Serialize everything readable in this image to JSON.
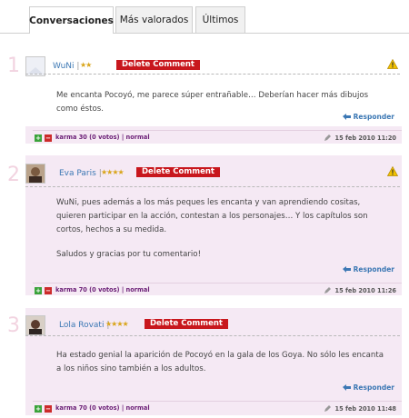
{
  "tabs": [
    "Conversaciones",
    "Más valorados",
    "Últimos"
  ],
  "delete_label": "Delete Comment",
  "reply_label": "Responder",
  "comments": [
    {
      "number": "1",
      "author": "WuNi",
      "stars": "★★",
      "body": [
        "Me encanta Pocoyó, me parece súper entrañable… Deberían hacer más dibujos como éstos."
      ],
      "karma": "karma 30 (0 votos) | normal",
      "date": "15 feb 2010 11:20",
      "avatar": "blank-avatar"
    },
    {
      "number": "2",
      "author": "Eva Paris",
      "stars": "★★★★",
      "body": [
        "WuNi, pues además a los más peques les encanta y van aprendiendo cositas, quieren participar en la acción, contestan a los personajes… Y los capítulos son cortos, hechos a su medida.",
        "Saludos y gracias por tu comentario!"
      ],
      "karma": "karma 70 (0 votos) | normal",
      "date": "15 feb 2010 11:26",
      "avatar": "photo-avatar"
    },
    {
      "number": "3",
      "author": "Lola Rovati",
      "stars": "★★★★",
      "body": [
        "Ha estado genial la aparición de Pocoyó en la gala de los Goya. No sólo les encanta a los niños sino también a los adultos."
      ],
      "karma": "karma 70 (0 votos) | normal",
      "date": "15 feb 2010 11:48",
      "avatar": "photo-avatar"
    }
  ],
  "colors": {
    "comment_bg": "#f5e9f4",
    "author": "#3c78b4",
    "delete_button": "#c8171d",
    "karma": "#6b1f76",
    "number": "#f2d3e0"
  }
}
